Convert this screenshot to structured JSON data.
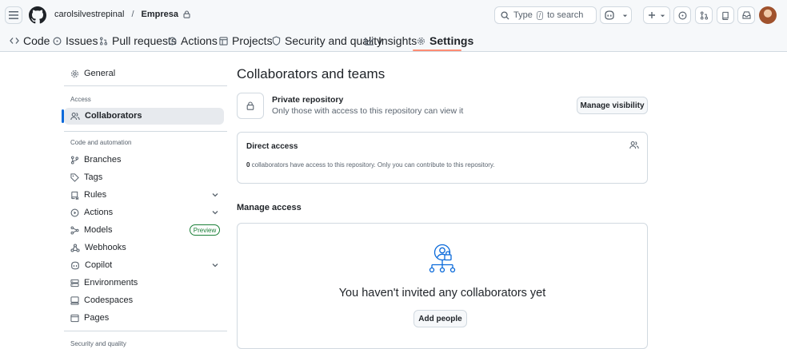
{
  "header": {
    "owner": "carolsilvestrepinal",
    "separator": "/",
    "repo": "Empresa",
    "search_placeholder_prefix": "Type",
    "search_key": "/",
    "search_placeholder_suffix": "to search"
  },
  "tabs": [
    {
      "label": "Code",
      "icon": "code-icon"
    },
    {
      "label": "Issues",
      "icon": "issue-icon"
    },
    {
      "label": "Pull requests",
      "icon": "pull-request-icon"
    },
    {
      "label": "Actions",
      "icon": "play-icon"
    },
    {
      "label": "Projects",
      "icon": "table-icon"
    },
    {
      "label": "Security and quality",
      "icon": "shield-icon"
    },
    {
      "label": "Insights",
      "icon": "graph-icon"
    },
    {
      "label": "Settings",
      "icon": "gear-icon",
      "active": true
    }
  ],
  "sidebar": {
    "general": "General",
    "access_heading": "Access",
    "collaborators": "Collaborators",
    "code_heading": "Code and automation",
    "items": {
      "branches": "Branches",
      "tags": "Tags",
      "rules": "Rules",
      "actions": "Actions",
      "models": "Models",
      "models_badge": "Preview",
      "webhooks": "Webhooks",
      "copilot": "Copilot",
      "environments": "Environments",
      "codespaces": "Codespaces",
      "pages": "Pages"
    },
    "security_heading": "Security and quality"
  },
  "main": {
    "title": "Collaborators and teams",
    "private_title": "Private repository",
    "private_desc": "Only those with access to this repository can view it",
    "manage_visibility": "Manage visibility",
    "direct_access_title": "Direct access",
    "direct_access_count": "0",
    "direct_access_desc": " collaborators have access to this repository. Only you can contribute to this repository.",
    "manage_access_title": "Manage access",
    "empty_message": "You haven't invited any collaborators yet",
    "add_people": "Add people"
  },
  "colors": {
    "accent": "#0969da",
    "tab_underline": "#fd8c73",
    "success": "#1a7f37",
    "border": "#d1d9e0",
    "muted": "#59636e"
  }
}
